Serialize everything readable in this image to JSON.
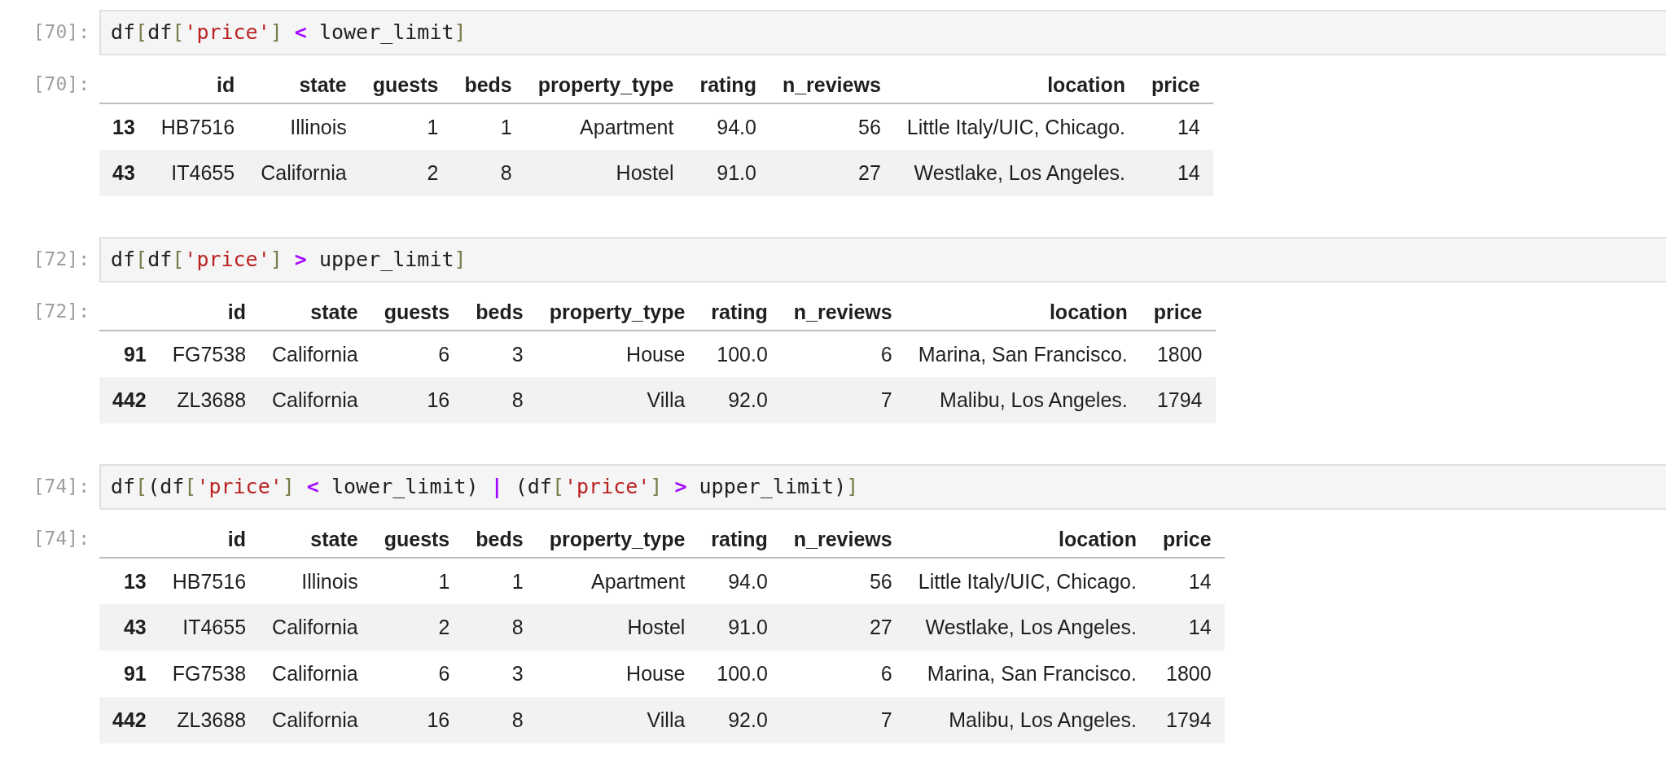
{
  "cells": [
    {
      "input_prompt": "[70]:",
      "code": [
        {
          "kind": "plain",
          "text": "df"
        },
        {
          "kind": "bracket",
          "text": "["
        },
        {
          "kind": "plain",
          "text": "df"
        },
        {
          "kind": "bracket",
          "text": "["
        },
        {
          "kind": "string",
          "text": "'price'"
        },
        {
          "kind": "bracket",
          "text": "]"
        },
        {
          "kind": "operator",
          "text": " < "
        },
        {
          "kind": "plain",
          "text": "lower_limit"
        },
        {
          "kind": "bracket",
          "text": "]"
        }
      ],
      "output_prompt": "[70]:",
      "table": {
        "columns": [
          "",
          "id",
          "state",
          "guests",
          "beds",
          "property_type",
          "rating",
          "n_reviews",
          "location",
          "price"
        ],
        "rows": [
          {
            "cells": [
              "13",
              "HB7516",
              "Illinois",
              "1",
              "1",
              "Apartment",
              "94.0",
              "56",
              "Little Italy/UIC, Chicago.",
              "14"
            ]
          },
          {
            "cells": [
              "43",
              "IT4655",
              "California",
              "2",
              "8",
              "Hostel",
              "91.0",
              "27",
              "Westlake, Los Angeles.",
              "14"
            ]
          }
        ]
      }
    },
    {
      "input_prompt": "[72]:",
      "code": [
        {
          "kind": "plain",
          "text": "df"
        },
        {
          "kind": "bracket",
          "text": "["
        },
        {
          "kind": "plain",
          "text": "df"
        },
        {
          "kind": "bracket",
          "text": "["
        },
        {
          "kind": "string",
          "text": "'price'"
        },
        {
          "kind": "bracket",
          "text": "]"
        },
        {
          "kind": "operator",
          "text": " > "
        },
        {
          "kind": "plain",
          "text": "upper_limit"
        },
        {
          "kind": "bracket",
          "text": "]"
        }
      ],
      "output_prompt": "[72]:",
      "table": {
        "columns": [
          "",
          "id",
          "state",
          "guests",
          "beds",
          "property_type",
          "rating",
          "n_reviews",
          "location",
          "price"
        ],
        "rows": [
          {
            "cells": [
              "91",
              "FG7538",
              "California",
              "6",
              "3",
              "House",
              "100.0",
              "6",
              "Marina, San Francisco.",
              "1800"
            ]
          },
          {
            "cells": [
              "442",
              "ZL3688",
              "California",
              "16",
              "8",
              "Villa",
              "92.0",
              "7",
              "Malibu, Los Angeles.",
              "1794"
            ]
          }
        ]
      }
    },
    {
      "input_prompt": "[74]:",
      "code": [
        {
          "kind": "plain",
          "text": "df"
        },
        {
          "kind": "bracket",
          "text": "["
        },
        {
          "kind": "plain",
          "text": "(df"
        },
        {
          "kind": "bracket",
          "text": "["
        },
        {
          "kind": "string",
          "text": "'price'"
        },
        {
          "kind": "bracket",
          "text": "]"
        },
        {
          "kind": "operator",
          "text": " < "
        },
        {
          "kind": "plain",
          "text": "lower_limit) "
        },
        {
          "kind": "operator",
          "text": "|"
        },
        {
          "kind": "plain",
          "text": " (df"
        },
        {
          "kind": "bracket",
          "text": "["
        },
        {
          "kind": "string",
          "text": "'price'"
        },
        {
          "kind": "bracket",
          "text": "]"
        },
        {
          "kind": "operator",
          "text": " > "
        },
        {
          "kind": "plain",
          "text": "upper_limit)"
        },
        {
          "kind": "bracket",
          "text": "]"
        }
      ],
      "output_prompt": "[74]:",
      "table": {
        "columns": [
          "",
          "id",
          "state",
          "guests",
          "beds",
          "property_type",
          "rating",
          "n_reviews",
          "location",
          "price"
        ],
        "rows": [
          {
            "cells": [
              "13",
              "HB7516",
              "Illinois",
              "1",
              "1",
              "Apartment",
              "94.0",
              "56",
              "Little Italy/UIC, Chicago.",
              "14"
            ]
          },
          {
            "cells": [
              "43",
              "IT4655",
              "California",
              "2",
              "8",
              "Hostel",
              "91.0",
              "27",
              "Westlake, Los Angeles.",
              "14"
            ]
          },
          {
            "cells": [
              "91",
              "FG7538",
              "California",
              "6",
              "3",
              "House",
              "100.0",
              "6",
              "Marina, San Francisco.",
              "1800"
            ]
          },
          {
            "cells": [
              "442",
              "ZL3688",
              "California",
              "16",
              "8",
              "Villa",
              "92.0",
              "7",
              "Malibu, Los Angeles.",
              "1794"
            ]
          }
        ]
      }
    }
  ]
}
